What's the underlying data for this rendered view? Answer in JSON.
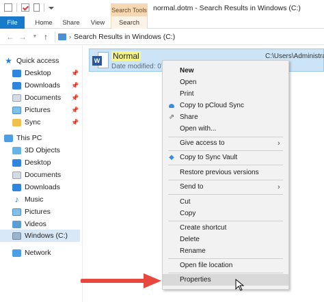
{
  "window": {
    "title": "normal.dotm - Search Results in Windows (C:)",
    "contextual_tab": "Search Tools"
  },
  "ribbon": {
    "tabs": [
      "File",
      "Home",
      "Share",
      "View",
      "Search"
    ]
  },
  "address": {
    "path": "Search Results in Windows (C:)"
  },
  "sidebar": {
    "items": [
      {
        "label": "Quick access",
        "icon": "star-icon"
      },
      {
        "label": "Desktop",
        "icon": "desktop-icon",
        "pinned": true
      },
      {
        "label": "Downloads",
        "icon": "downloads-icon",
        "pinned": true
      },
      {
        "label": "Documents",
        "icon": "documents-icon",
        "pinned": true
      },
      {
        "label": "Pictures",
        "icon": "pictures-icon",
        "pinned": true
      },
      {
        "label": "Sync",
        "icon": "sync-folder-icon",
        "pinned": true
      },
      {
        "label": "This PC",
        "icon": "computer-icon"
      },
      {
        "label": "3D Objects",
        "icon": "3d-objects-icon"
      },
      {
        "label": "Desktop",
        "icon": "desktop-icon"
      },
      {
        "label": "Documents",
        "icon": "documents-icon"
      },
      {
        "label": "Downloads",
        "icon": "downloads-icon"
      },
      {
        "label": "Music",
        "icon": "music-icon"
      },
      {
        "label": "Pictures",
        "icon": "pictures-icon"
      },
      {
        "label": "Videos",
        "icon": "videos-icon"
      },
      {
        "label": "Windows (C:)",
        "icon": "drive-icon",
        "selected": true
      },
      {
        "label": "Network",
        "icon": "network-icon"
      }
    ],
    "pin_glyph": "📌"
  },
  "result": {
    "name": "Normal",
    "meta": "Date modified: 07/",
    "path": "C:\\Users\\Administrato",
    "icon": "word-document-icon",
    "badge": "W"
  },
  "context_menu": {
    "items": [
      {
        "label": "New",
        "bold": true
      },
      {
        "label": "Open"
      },
      {
        "label": "Print"
      },
      {
        "label": "Copy to pCloud Sync",
        "icon": "pcloud-icon"
      },
      {
        "label": "Share",
        "icon": "share-icon"
      },
      {
        "label": "Open with..."
      },
      {
        "label": "Give access to",
        "submenu": true
      },
      {
        "label": "Copy to Sync Vault",
        "icon": "sync-vault-icon"
      },
      {
        "label": "Restore previous versions"
      },
      {
        "label": "Send to",
        "submenu": true
      },
      {
        "label": "Cut"
      },
      {
        "label": "Copy"
      },
      {
        "label": "Create shortcut"
      },
      {
        "label": "Delete"
      },
      {
        "label": "Rename"
      },
      {
        "label": "Open file location"
      },
      {
        "label": "Properties",
        "hovered": true
      }
    ]
  },
  "colors": {
    "accent": "#1979ca",
    "selection": "#cce4f7",
    "search_tools": "#f6d9b4",
    "annotation_arrow": "#e8473f"
  }
}
